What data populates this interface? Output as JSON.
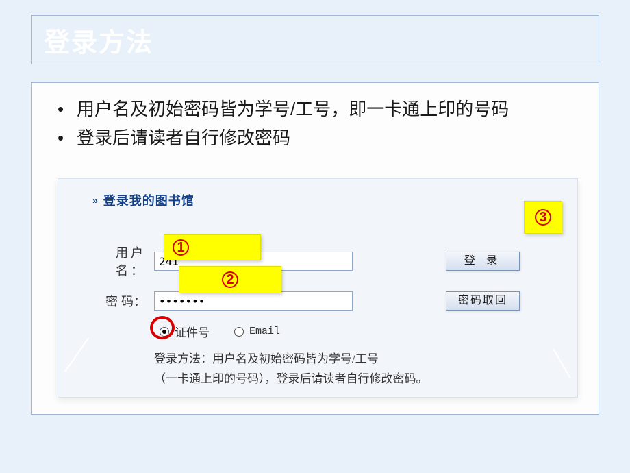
{
  "title": "登录方法",
  "bullets": [
    "用户名及初始密码皆为学号/工号，即一卡通上印的号码",
    "登录后请读者自行修改密码"
  ],
  "panel": {
    "header": "登录我的图书馆",
    "username_label": "用户名：",
    "username_value": "241",
    "password_label": "密  码：",
    "password_value": "•••••••",
    "login_btn": "登   录",
    "recover_btn": "密码取回",
    "radio_id": "证件号",
    "radio_email": "Email",
    "help_line1": "登录方法：用户名及初始密码皆为学号/工号",
    "help_line2": "（一卡通上印的号码），登录后请读者自行修改密码。"
  },
  "callouts": {
    "n1": "1",
    "n2": "2",
    "n3": "3"
  }
}
